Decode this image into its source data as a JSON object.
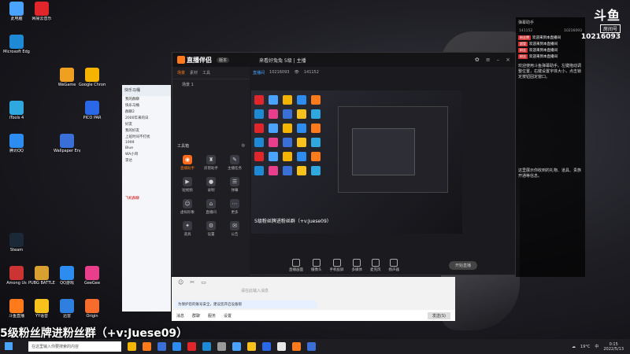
{
  "desktop": {
    "icons": [
      {
        "label": "此电脑",
        "color": "#4aa3ff",
        "col": 0,
        "row": 0
      },
      {
        "label": "网易云音乐",
        "color": "#e0262b",
        "col": 1,
        "row": 0
      },
      {
        "label": "Microsoft Edge",
        "color": "#1e8ad6",
        "col": 0,
        "row": 1
      },
      {
        "label": "腾讯QQ",
        "color": "#2d8cf0",
        "col": 0,
        "row": 4
      },
      {
        "label": "Google Chrome",
        "color": "#f4b400",
        "col": 3,
        "row": 2
      },
      {
        "label": "WeGame",
        "color": "#f0a020",
        "col": 2,
        "row": 2
      },
      {
        "label": "iTools 4",
        "color": "#2fa8e0",
        "col": 0,
        "row": 3
      },
      {
        "label": "PICO PAR",
        "color": "#2b68e8",
        "col": 3,
        "row": 3
      },
      {
        "label": "Wallpaper Engine",
        "color": "#3a6fd8",
        "col": 2,
        "row": 4
      },
      {
        "label": "Steam",
        "color": "#1b2838",
        "col": 0,
        "row": 7
      },
      {
        "label": "Origin",
        "color": "#f56c2d",
        "col": 3,
        "row": 9
      },
      {
        "label": "GeeGee",
        "color": "#e83e8c",
        "col": 3,
        "row": 8
      },
      {
        "label": "QQ游戏",
        "color": "#2d8cf0",
        "col": 2,
        "row": 8
      },
      {
        "label": "Among Us",
        "color": "#c33",
        "col": 0,
        "row": 8
      },
      {
        "label": "PUBG BATTLEGR",
        "color": "#d8a030",
        "col": 1,
        "row": 8
      },
      {
        "label": "斗鱼直播",
        "color": "#ff7a1a",
        "col": 0,
        "row": 9
      },
      {
        "label": "YY语音",
        "color": "#f9c11b",
        "col": 1,
        "row": 9
      },
      {
        "label": "迅雷",
        "color": "#2e7fe0",
        "col": 2,
        "row": 9
      }
    ]
  },
  "stream_app": {
    "title": "直播伴侣",
    "version": "版本",
    "window_title": "来看好兔兔 5级 | 主播",
    "tabs": [
      "场景",
      "素材",
      "工具"
    ],
    "scene": "场景 1",
    "tools_header": "工具箱",
    "tools": [
      {
        "label": "直播助手",
        "icon": "◉",
        "hot": true
      },
      {
        "label": "房管助手",
        "icon": "♜",
        "hot": false
      },
      {
        "label": "主播任务",
        "icon": "✎",
        "hot": false
      },
      {
        "label": "短视频",
        "icon": "▶",
        "hot": false
      },
      {
        "label": "录制",
        "icon": "●",
        "hot": false
      },
      {
        "label": "弹幕",
        "icon": "☰",
        "hot": false
      },
      {
        "label": "虚拟形象",
        "icon": "☺",
        "hot": false
      },
      {
        "label": "直播间",
        "icon": "⌂",
        "hot": false
      },
      {
        "label": "更多",
        "icon": "⋯",
        "hot": false
      },
      {
        "label": "道具",
        "icon": "✦",
        "hot": false
      },
      {
        "label": "设置",
        "icon": "⚙",
        "hot": false
      },
      {
        "label": "公告",
        "icon": "✉",
        "hot": false
      }
    ],
    "room_label": "直播间",
    "room_id": "10216093",
    "viewers": "141152",
    "preview_caption": "5级粉丝牌进粉丝群（+v:Juese09）",
    "bottom_buttons": [
      "直播画面",
      "摄像头",
      "手机投屏",
      "多媒体",
      "麦克风",
      "扬声器"
    ],
    "start_button": "开始直播"
  },
  "chat_app": {
    "header": "快乐马桶",
    "rows": [
      "我的群聊",
      "快乐马桶",
      "群聊2",
      "2000年来的日",
      "好友",
      "我的好友",
      "上班时间不打扰",
      "1999",
      "Blue",
      "WA小哥",
      "李达"
    ],
    "warning_row": "飞机群聊"
  },
  "message_box": {
    "placeholder": "请在此输入消息",
    "notice": "为保护您的账号安全，建议您开启设备锁",
    "footer_items": [
      "消息",
      "群聊",
      "服务",
      "设置"
    ],
    "send_label": "发送(S)"
  },
  "danmu_panel": {
    "header": "弹幕助手",
    "stats": [
      "141152",
      "10216093"
    ],
    "lines": [
      {
        "badge": "粉丝牌",
        "text": "欢迎来到本直播间"
      },
      {
        "badge": "超管",
        "text": "欢迎来到本直播间"
      },
      {
        "badge": "粉丝",
        "text": "欢迎来到本直播间"
      },
      {
        "badge": "粉丝",
        "text": "欢迎来到本直播间"
      }
    ],
    "notice": "欢迎使用斗鱼弹幕助手。左键拖动调整位置，右键设置字体大小，点击锁定按钮固定窗口。",
    "notice2": "这里展示你收到的礼物、道具、贵族开通等信息。"
  },
  "douyu": {
    "logo": "斗鱼",
    "tag": "房间号",
    "room_id": "10216093"
  },
  "banner": {
    "text": "5级粉丝牌进粉丝群（+v:Juese09）"
  },
  "taskbar": {
    "search_placeholder": "在这里输入你要搜索的内容",
    "temperature": "19°C",
    "time": "0:15",
    "date": "2022/5/13",
    "ime": "中",
    "app_colors": [
      "#f4b400",
      "#ff7a1a",
      "#3a6fd8",
      "#2d8cf0",
      "#e0262b",
      "#1e8ad6",
      "#999",
      "#4aa3ff",
      "#f9c11b",
      "#2b68e8",
      "#e8e8e8",
      "#ff7a1a",
      "#3a6fd8"
    ]
  }
}
